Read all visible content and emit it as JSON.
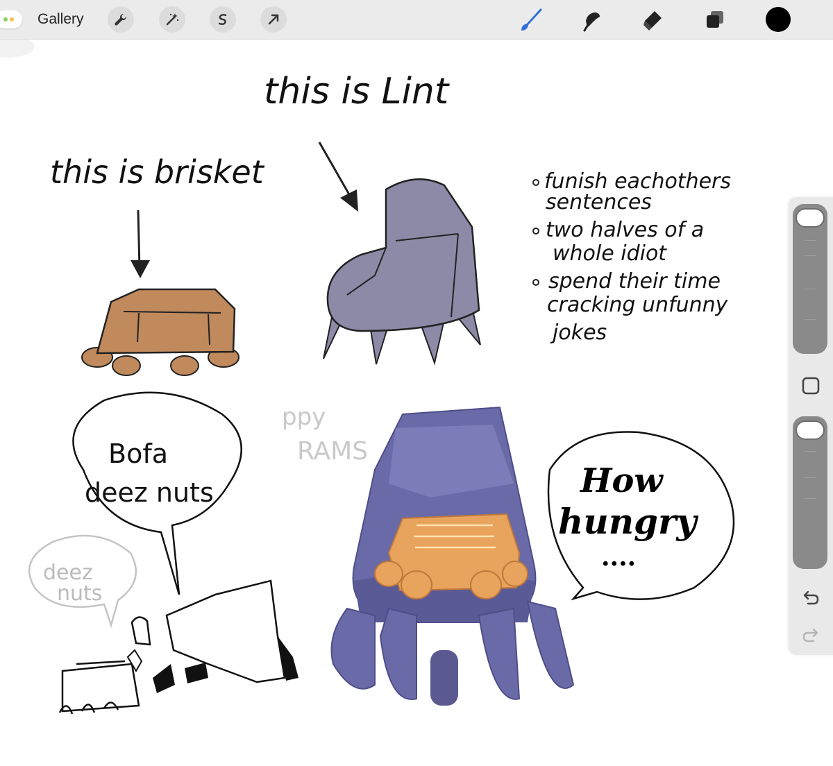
{
  "toolbar": {
    "gallery_label": "Gallery",
    "left_tools": [
      "wrench-icon",
      "magic-wand-icon",
      "selection-s-icon",
      "transform-arrow-icon"
    ],
    "right_tools": [
      "brush-icon",
      "smudge-icon",
      "eraser-icon",
      "layers-icon",
      "color-swatch"
    ],
    "active_tool": "brush-icon",
    "accent_color": "#2f6fd6",
    "current_color": "#000000"
  },
  "sidebar": {
    "size_slider_label": "brush-size-slider",
    "opacity_slider_label": "brush-opacity-slider",
    "modify_button": "square-modify-icon",
    "undo_icon": "undo-icon",
    "redo_icon": "redo-icon"
  },
  "canvas": {
    "title_lint": "this is Lint",
    "title_brisket": "this is brisket",
    "notes": [
      "funish eachothers",
      "sentences",
      "two halves of a",
      "whole idiot",
      "spend their time",
      "cracking unfunny",
      "jokes"
    ],
    "speech_left": [
      "Bofa",
      "deez nuts"
    ],
    "speech_small": [
      "deez",
      "nuts"
    ],
    "speech_right": [
      "How",
      "hungry",
      "...."
    ],
    "watermark": [
      "ppy",
      "RAMS"
    ],
    "colors": {
      "brisket": "#c08a5c",
      "lint": "#8c8aa6",
      "lint_painted": "#6a6aa8"
    }
  }
}
